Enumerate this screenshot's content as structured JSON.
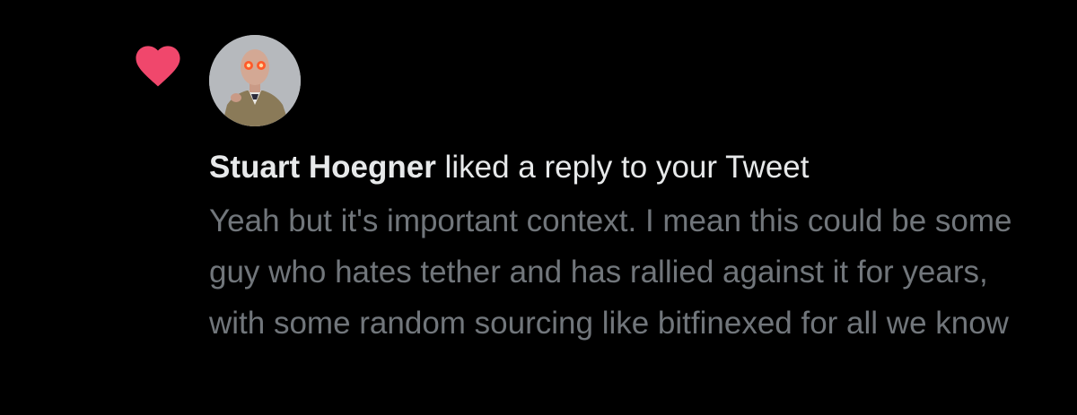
{
  "notification": {
    "icon": "heart-icon",
    "accent_color": "#f91880",
    "author_name": "Stuart Hoegner",
    "action_text": "liked a reply to your Tweet",
    "reply_text": "Yeah but it's important context. I mean this could be some guy who hates tether and has rallied against it for years, with some random sourcing like bitfinexed for all we know"
  }
}
